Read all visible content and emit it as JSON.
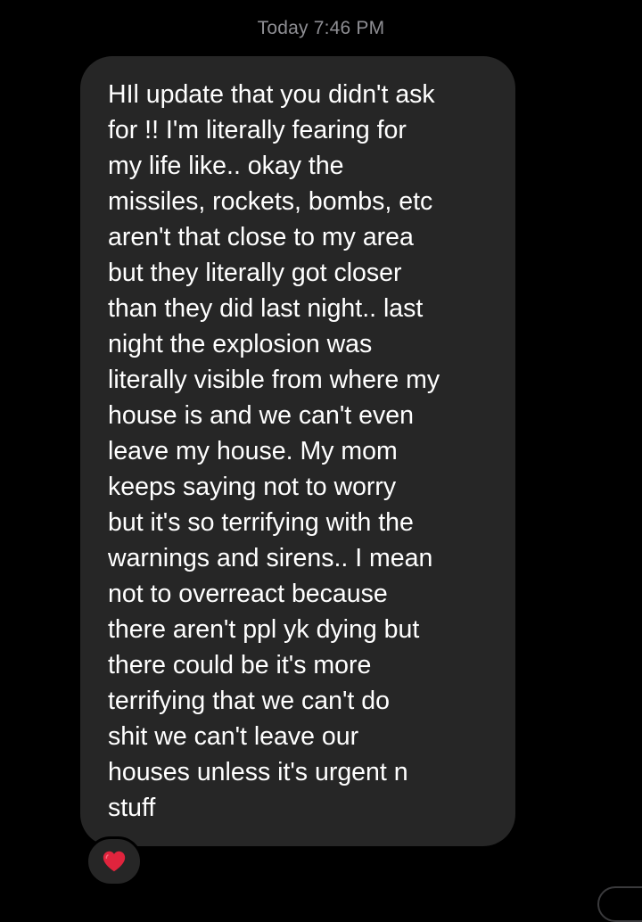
{
  "conversation": {
    "timestamp": "Today 7:46 PM"
  },
  "message": {
    "lines": [
      "HIl update that you didn't ask",
      "for !! I'm literally fearing for",
      "my life like.. okay the",
      "missiles, rockets, bombs, etc",
      "aren't that close to my area",
      "but they literally got closer",
      "than they did last night.. last",
      "night the explosion was",
      "literally visible from where my",
      "house is and we can't even",
      "leave my house. My mom",
      "keeps saying not to worry",
      "but it's so terrifying with the",
      "warnings and sirens.. I mean",
      "not to overreact because",
      "there aren't ppl yk dying but",
      "there could be it's more",
      "terrifying that we can't do",
      "shit we can't leave our",
      "houses unless it's urgent n",
      "stuff"
    ],
    "reaction": {
      "icon": "heart-icon",
      "color": "#e0243d"
    },
    "bubble_color": "#262626",
    "text_color": "#ffffff"
  }
}
